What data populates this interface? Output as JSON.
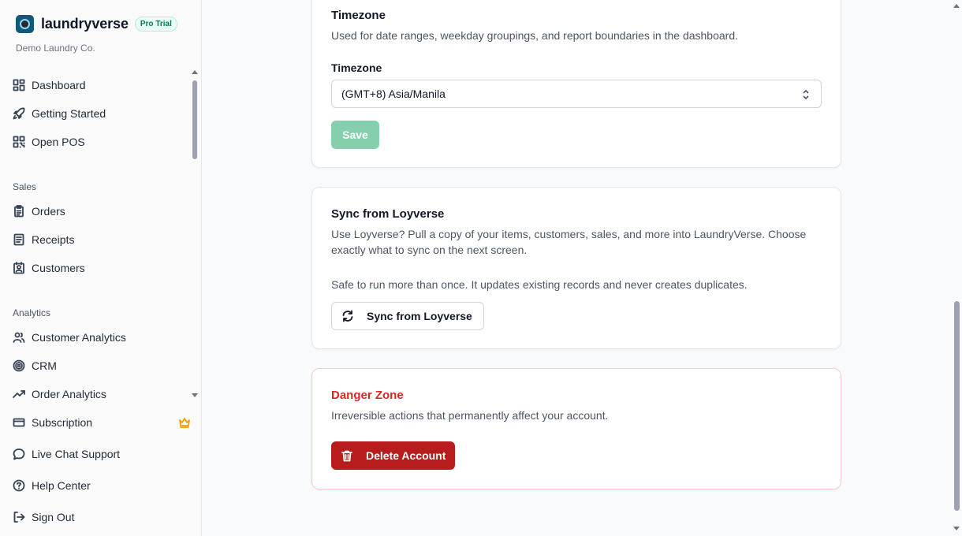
{
  "sidebar": {
    "brand_name": "laundryverse",
    "badge": "Pro Trial",
    "org": "Demo Laundry Co.",
    "items_top": [
      {
        "label": "Dashboard",
        "icon": "dashboard-icon"
      },
      {
        "label": "Getting Started",
        "icon": "rocket-icon"
      },
      {
        "label": "Open POS",
        "icon": "qr-icon"
      }
    ],
    "sales_label": "Sales",
    "items_sales": [
      {
        "label": "Orders",
        "icon": "clipboard-icon"
      },
      {
        "label": "Receipts",
        "icon": "receipt-icon"
      },
      {
        "label": "Customers",
        "icon": "contact-icon"
      }
    ],
    "analytics_label": "Analytics",
    "items_analytics": [
      {
        "label": "Customer Analytics",
        "icon": "users-icon"
      },
      {
        "label": "CRM",
        "icon": "target-icon"
      },
      {
        "label": "Order Analytics",
        "icon": "trending-up-icon"
      },
      {
        "label": "Subscription",
        "icon": "credit-card-icon"
      }
    ],
    "items_bottom": [
      {
        "label": "Live Chat Support",
        "icon": "chat-icon"
      },
      {
        "label": "Help Center",
        "icon": "help-icon"
      },
      {
        "label": "Sign Out",
        "icon": "sign-out-icon"
      }
    ]
  },
  "timezone_card": {
    "title": "Timezone",
    "description": "Used for date ranges, weekday groupings, and report boundaries in the dashboard.",
    "field_label": "Timezone",
    "selected": "(GMT+8) Asia/Manila",
    "save_label": "Save"
  },
  "sync_card": {
    "title": "Sync from Loyverse",
    "description": "Use Loyverse? Pull a copy of your items, customers, sales, and more into LaundryVerse. Choose exactly what to sync on the next screen.",
    "note": "Safe to run more than once. It updates existing records and never creates duplicates.",
    "button_label": "Sync from Loyverse"
  },
  "danger_card": {
    "title": "Danger Zone",
    "description": "Irreversible actions that permanently affect your account.",
    "button_label": "Delete Account"
  },
  "colors": {
    "accent_green": "#86cfae",
    "danger_red": "#b91c1c",
    "danger_title": "#dc2626",
    "crown": "#f59e0b"
  }
}
